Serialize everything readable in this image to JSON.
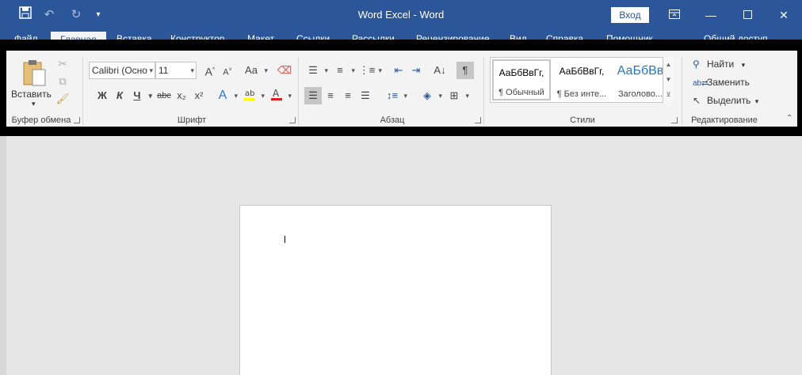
{
  "titlebar": {
    "title": "Word Excel  -  Word",
    "login_label": "Вход",
    "save_icon": "save-icon",
    "undo_icon": "undo-icon",
    "redo_icon": "redo-icon"
  },
  "tabs": [
    {
      "label": "Файл"
    },
    {
      "label": "Главная"
    },
    {
      "label": "Вставка"
    },
    {
      "label": "Конструктор"
    },
    {
      "label": "Макет"
    },
    {
      "label": "Ссылки"
    },
    {
      "label": "Рассылки"
    },
    {
      "label": "Рецензирование"
    },
    {
      "label": "Вид"
    },
    {
      "label": "Справка"
    },
    {
      "label": "Помощник"
    },
    {
      "label": "Общий доступ"
    }
  ],
  "ribbon": {
    "clipboard": {
      "paste_label": "Вставить",
      "group_label": "Буфер обмена"
    },
    "font": {
      "font_name": "Calibri (Осно",
      "font_size": "11",
      "grow_glyph": "A",
      "shrink_glyph": "A",
      "case_glyph": "Aa",
      "bold": "Ж",
      "italic": "К",
      "underline": "Ч",
      "strike": "abc",
      "subscript": "x₂",
      "superscript": "x²",
      "group_label": "Шрифт"
    },
    "paragraph": {
      "group_label": "Абзац",
      "pilcrow": "¶"
    },
    "styles": {
      "group_label": "Стили",
      "items": [
        {
          "preview": "АаБбВвГг,",
          "name": "¶ Обычный"
        },
        {
          "preview": "АаБбВвГг,",
          "name": "¶ Без инте..."
        },
        {
          "preview": "АаБбВв",
          "name": "Заголово..."
        }
      ]
    },
    "editing": {
      "find_label": "Найти",
      "replace_label": "Заменить",
      "select_label": "Выделить",
      "group_label": "Редактирование"
    }
  },
  "colors": {
    "titlebar": "#2b579a",
    "ribbon": "#f3f3f3",
    "frame": "#000000",
    "canvas": "#e6e6e6"
  }
}
